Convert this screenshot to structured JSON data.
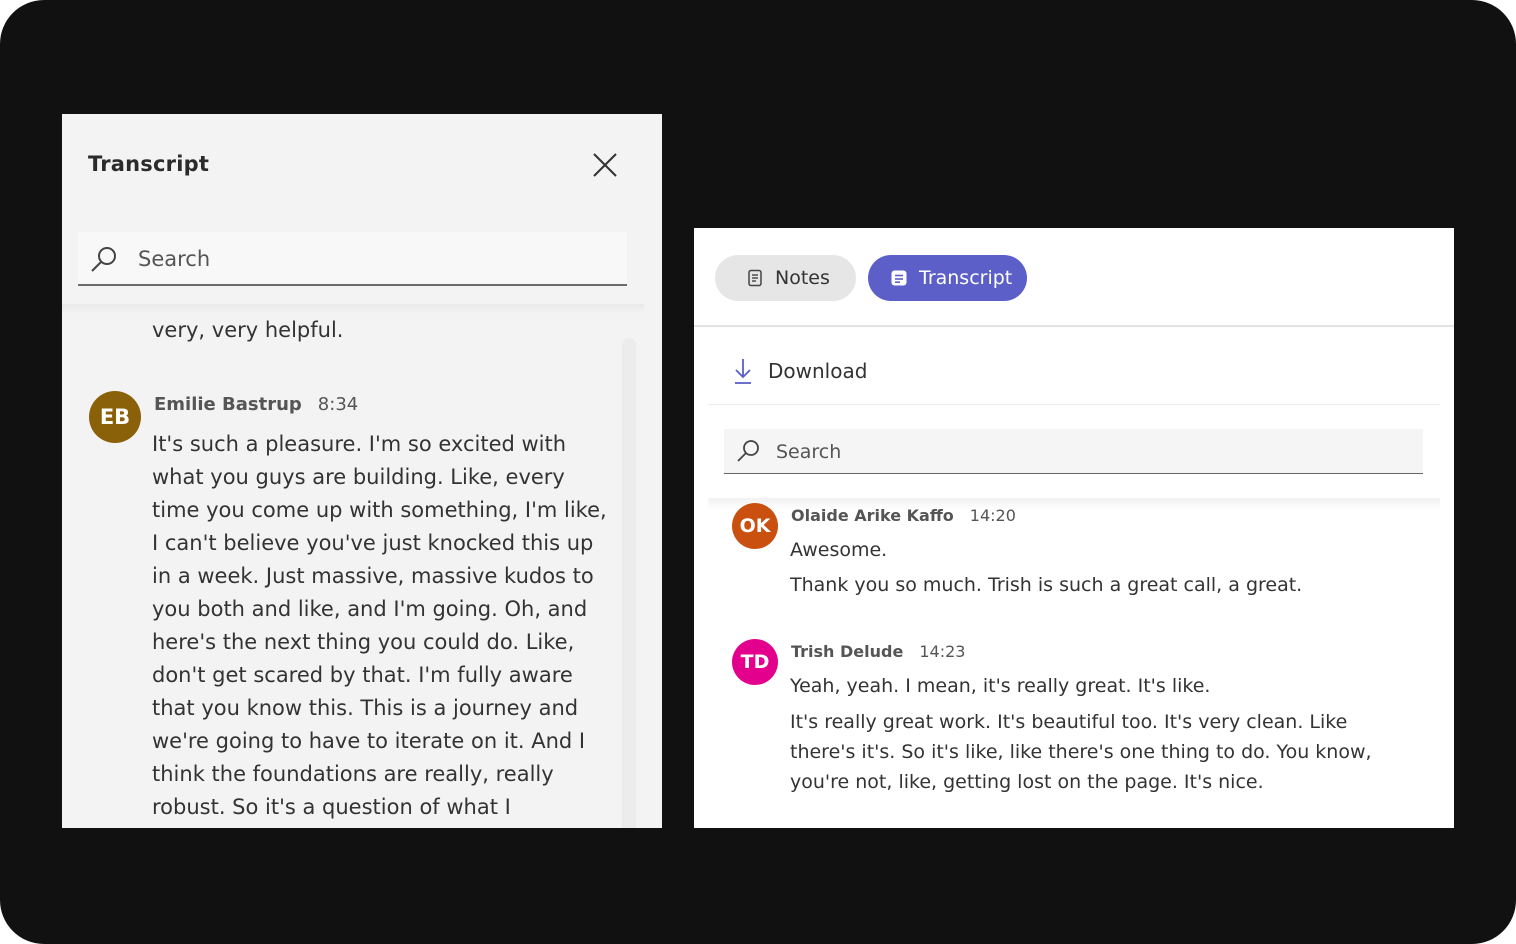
{
  "left_panel": {
    "title": "Transcript",
    "search_placeholder": "Search",
    "previous_text": "very, very helpful.",
    "entry": {
      "initials": "EB",
      "name": "Emilie Bastrup",
      "time": "8:34",
      "text": "It's such a pleasure. I'm so excited with what you guys are building. Like, every time you come up with something, I'm like, I can't believe you've just knocked this up in a week. Just massive, massive kudos to you both and like, and I'm going. Oh, and here's the next thing you could do. Like, don't get scared by that. I'm fully aware that you know this. This is a journey and we're going to have to iterate on it. And I think the foundations are really, really robust. So it's a question of what I",
      "avatar_color": "#8a6009"
    }
  },
  "right_panel": {
    "tabs": [
      {
        "label": "Notes",
        "icon": "notes-icon",
        "active": false
      },
      {
        "label": "Transcript",
        "icon": "transcript-icon",
        "active": true
      }
    ],
    "download_label": "Download",
    "search_placeholder": "Search",
    "entries": [
      {
        "initials": "OK",
        "name": "Olaide Arike Kaffo",
        "time": "14:20",
        "avatar_color": "#ca5010",
        "lines": [
          "Awesome.",
          "Thank you so much. Trish is such a great call, a great."
        ]
      },
      {
        "initials": "TD",
        "name": "Trish Delude",
        "time": "14:23",
        "avatar_color": "#e3008c",
        "lines": [
          "Yeah, yeah. I mean, it's really great. It's like.",
          "It's really great work. It's beautiful too. It's very clean. Like there's it's. So it's like, like there's one thing to do. You know, you're not, like, getting lost on the page. It's nice."
        ]
      }
    ]
  },
  "colors": {
    "accent": "#5b5fc7",
    "background": "#111111"
  }
}
